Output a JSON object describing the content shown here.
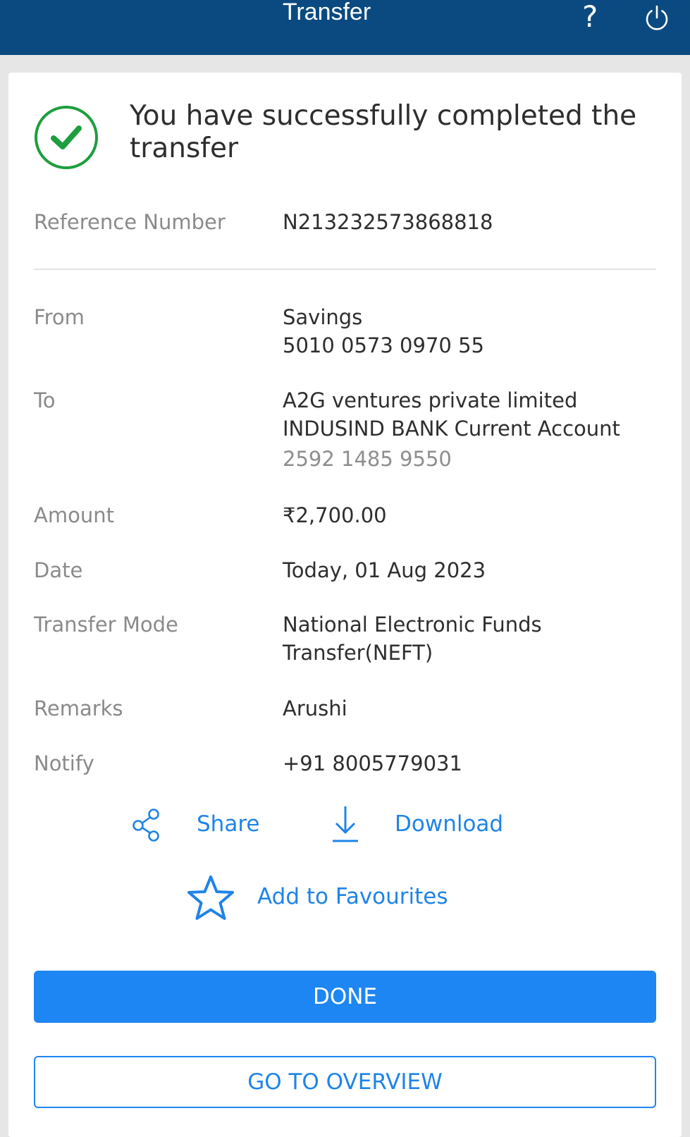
{
  "header": {
    "title": "Transfer",
    "help_glyph": "?",
    "help_icon": "help-icon",
    "power_icon": "power-icon",
    "bar_color": "#0a4a80"
  },
  "success": {
    "icon": "check-circle-icon",
    "message": "You have successfully completed the transfer",
    "accent": "#1e9e3e"
  },
  "details": {
    "reference": {
      "label": "Reference Number",
      "value": "N213232573868818"
    },
    "from": {
      "label": "From",
      "account_type": "Savings",
      "account_number": "5010 0573 0970 55"
    },
    "to": {
      "label": "To",
      "name": "A2G ventures private limited",
      "bank": "INDUSIND BANK Current Account",
      "account_number": "2592 1485 9550"
    },
    "amount": {
      "label": "Amount",
      "value": "₹2,700.00"
    },
    "date": {
      "label": "Date",
      "value": "Today, 01 Aug 2023"
    },
    "mode": {
      "label": "Transfer Mode",
      "value_line1": "National Electronic Funds",
      "value_line2": "Transfer(NEFT)"
    },
    "remarks": {
      "label": "Remarks",
      "value": "Arushi"
    },
    "notify": {
      "label": "Notify",
      "value": "+91 8005779031"
    }
  },
  "actions": {
    "share": {
      "label": "Share",
      "icon": "share-icon"
    },
    "download": {
      "label": "Download",
      "icon": "download-icon"
    },
    "favourites": {
      "label": "Add to Favourites",
      "icon": "star-icon"
    },
    "link_color": "#1f84e6"
  },
  "buttons": {
    "done": "DONE",
    "overview": "GO TO OVERVIEW",
    "primary_color": "#1e86f2"
  }
}
